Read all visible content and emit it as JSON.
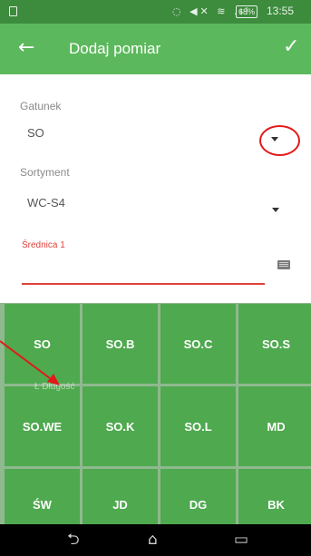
{
  "status_bar": {
    "icons": "◌ ◀✕ ≋ .ıl",
    "battery": "68%",
    "time": "13:55"
  },
  "app_bar": {
    "title": "Dodaj pomiar",
    "back_glyph": "←",
    "confirm_glyph": "✓"
  },
  "form": {
    "gatunek": {
      "label": "Gatunek",
      "value": "SO"
    },
    "sortyment": {
      "label": "Sortyment",
      "value": "WC-S4"
    },
    "srednica": {
      "label": "Średnica 1",
      "value": ""
    }
  },
  "keyboard": {
    "keys": [
      "SO",
      "SO.B",
      "SO.C",
      "SO.S",
      "SO.WE",
      "SO.K",
      "SO.L",
      "MD",
      "ŚW",
      "JD",
      "DG",
      "BK"
    ]
  },
  "ghost_text": "Ł Długość",
  "nav": {
    "back_glyph": "⮌",
    "home_glyph": "⌂",
    "recents_glyph": "▭"
  },
  "colors": {
    "status_bar": "#3d8b3d",
    "app_bar": "#5cb85c",
    "key": "#4fa94f",
    "accent_red": "#e0413b",
    "annotation_red": "#e31919"
  }
}
